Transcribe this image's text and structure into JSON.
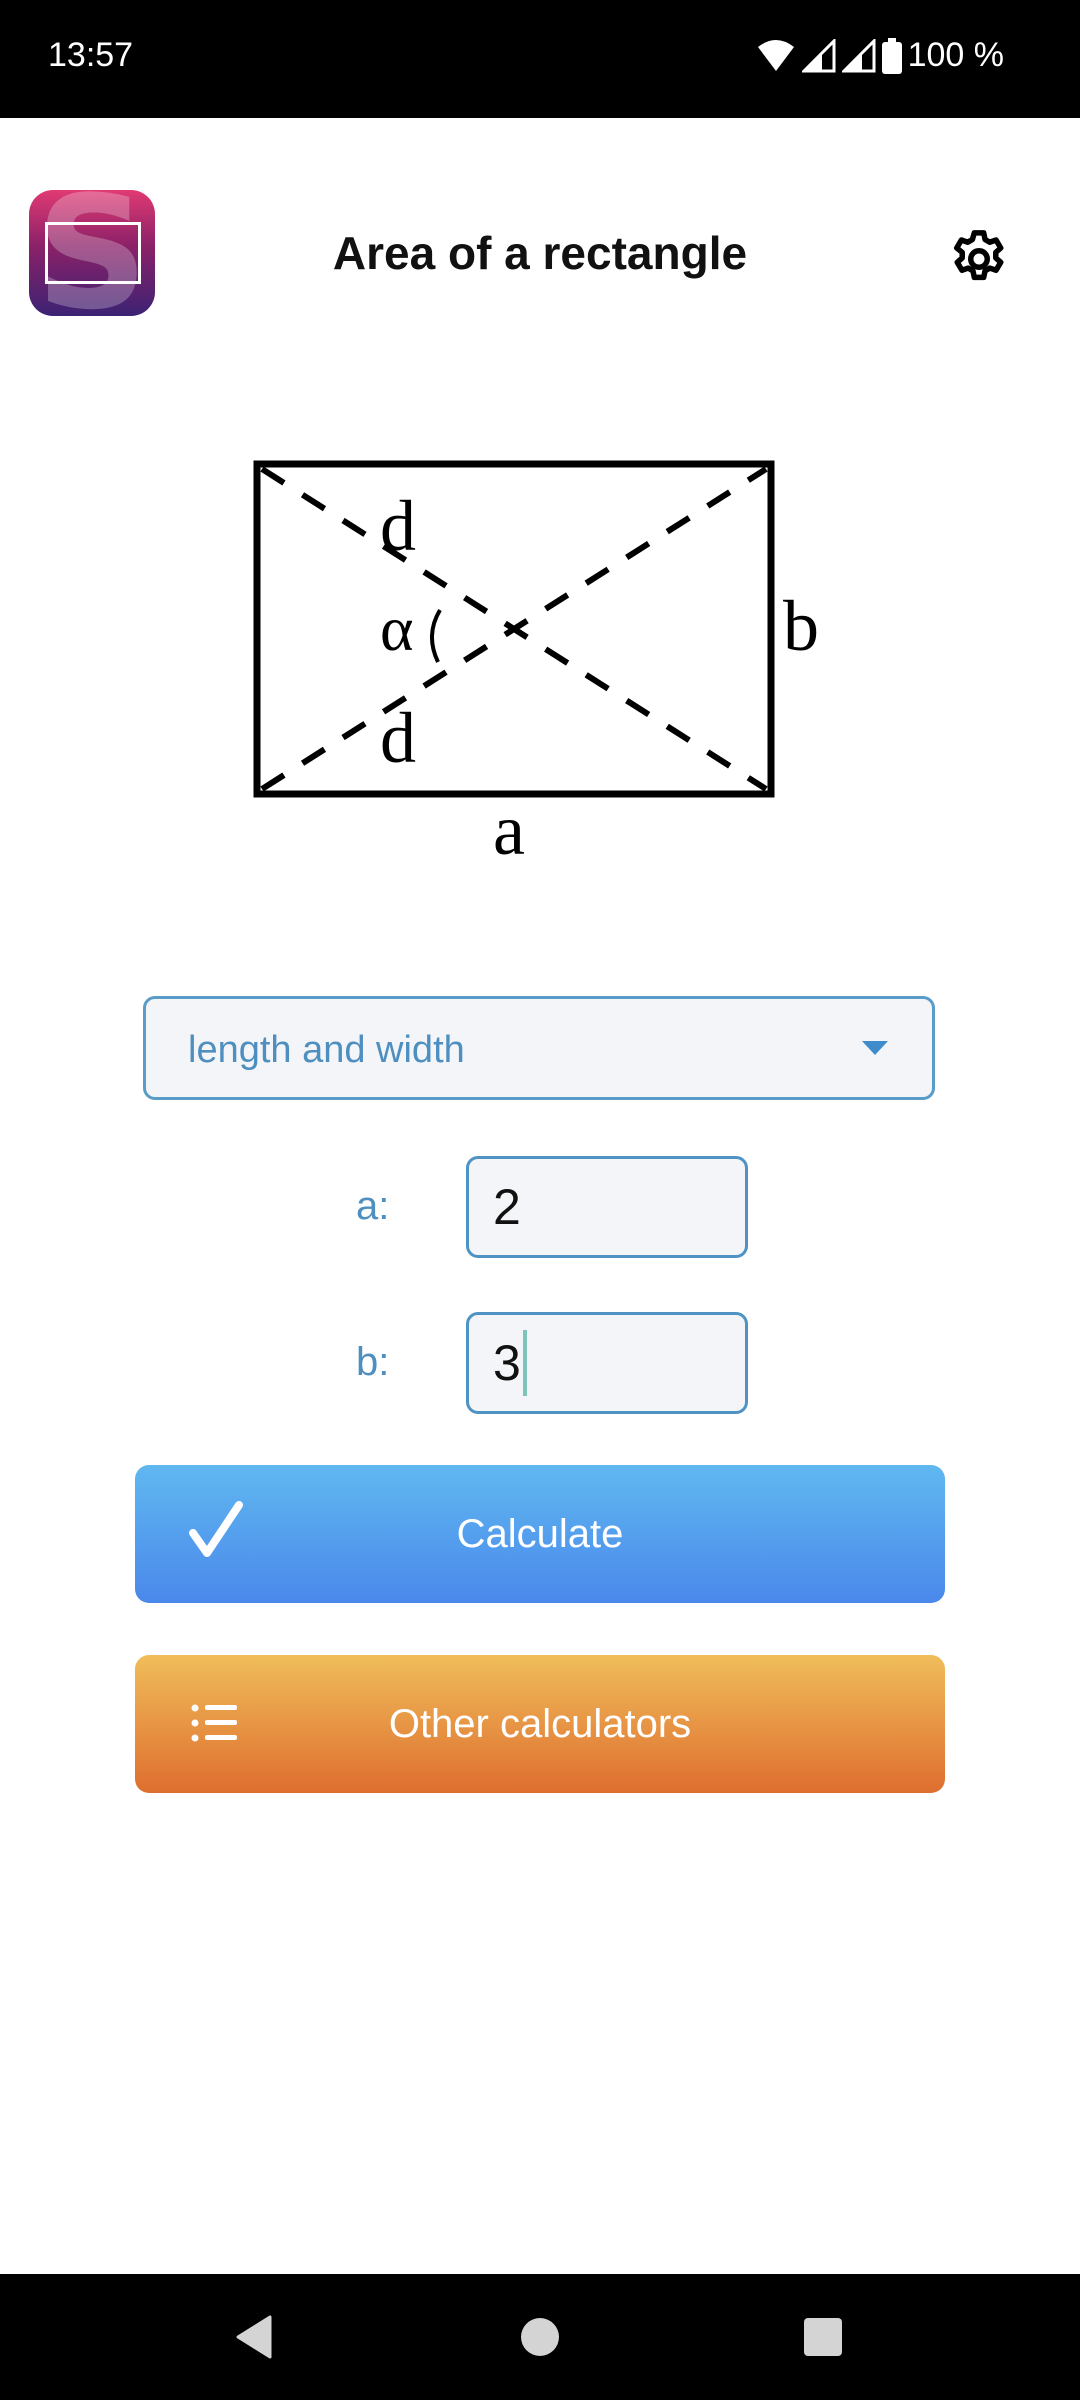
{
  "status_bar": {
    "time": "13:57",
    "battery_percent": "100 %",
    "icons": [
      "wifi-icon",
      "signal-icon",
      "signal-icon",
      "battery-icon"
    ]
  },
  "header": {
    "title": "Area of a rectangle",
    "logo_icon": "app-logo-icon",
    "settings_icon": "gear-icon"
  },
  "diagram": {
    "labels": {
      "diagonal_top": "d",
      "diagonal_bottom": "d",
      "angle": "α",
      "side_right": "b",
      "side_bottom": "a"
    }
  },
  "form": {
    "mode_select": {
      "selected": "length and width"
    },
    "fields": [
      {
        "label": "a:",
        "value": "2"
      },
      {
        "label": "b:",
        "value": "3"
      }
    ]
  },
  "buttons": {
    "calculate": {
      "label": "Calculate",
      "icon": "check-icon"
    },
    "other": {
      "label": "Other calculators",
      "icon": "list-icon"
    }
  },
  "colors": {
    "accent": "#4f8fc0",
    "calculate_top": "#60b8f0",
    "calculate_bottom": "#4a88eb",
    "other_top": "#f0bd5a",
    "other_bottom": "#de6e2f"
  },
  "nav_bar": {
    "icons": [
      "back-icon",
      "home-icon",
      "recents-icon"
    ]
  }
}
